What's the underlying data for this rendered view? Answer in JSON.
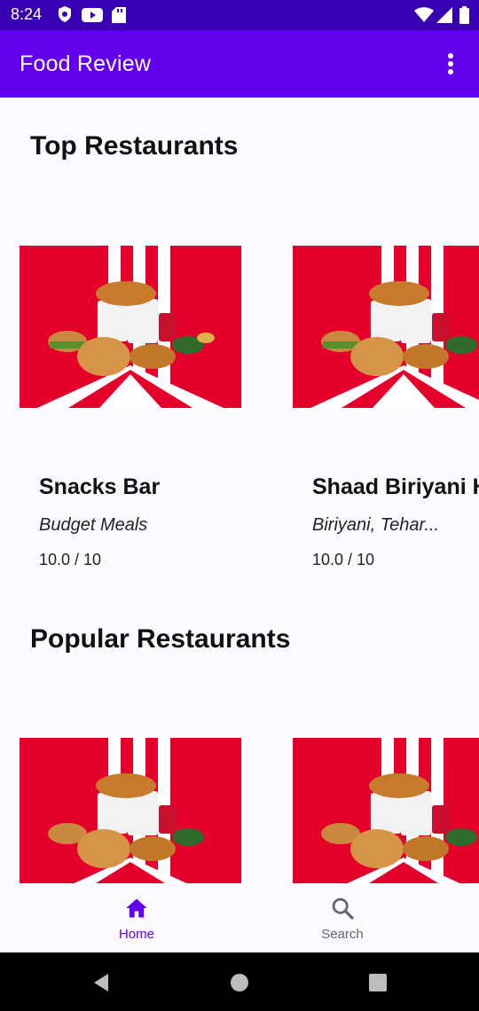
{
  "status_bar": {
    "time": "8:24",
    "left_icons": [
      "shield-icon",
      "youtube-icon",
      "sd-card-icon"
    ],
    "right_icons": [
      "wifi-icon",
      "signal-icon",
      "battery-icon"
    ]
  },
  "app_bar": {
    "title": "Food Review",
    "menu_icon": "more-vert-icon"
  },
  "sections": [
    {
      "title": "Top Restaurants",
      "cards": [
        {
          "name": "Snacks Bar",
          "cuisine": "Budget Meals",
          "rating": "10.0 / 10"
        },
        {
          "name": "Shaad Biriyani House",
          "cuisine": "Biriyani, Tehar...",
          "rating": "10.0 / 10"
        }
      ]
    },
    {
      "title": "Popular Restaurants",
      "cards": [
        {
          "name": "",
          "cuisine": "",
          "rating": ""
        },
        {
          "name": "",
          "cuisine": "",
          "rating": ""
        }
      ]
    }
  ],
  "bottom_nav": {
    "items": [
      {
        "label": "Home",
        "icon": "home-icon",
        "active": true
      },
      {
        "label": "Search",
        "icon": "search-icon",
        "active": false
      }
    ]
  },
  "colors": {
    "status_bar": "#3700B3",
    "app_bar": "#6200EE",
    "accent": "#6200EE",
    "inactive": "#666666",
    "brand_red": "#E4002B"
  }
}
